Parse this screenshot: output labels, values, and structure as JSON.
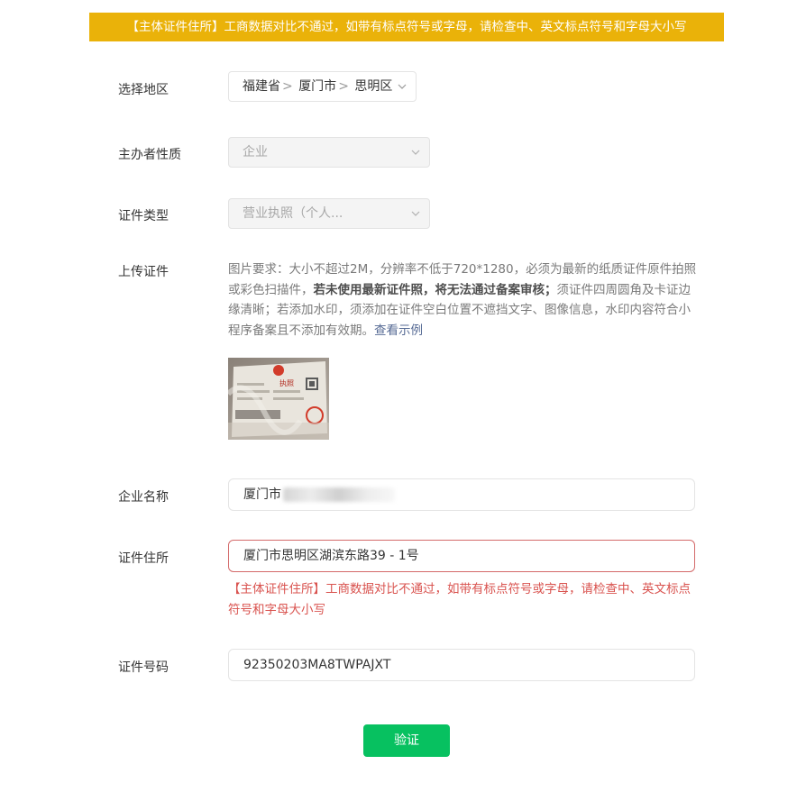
{
  "banner": {
    "text": "【主体证件住所】工商数据对比不通过，如带有标点符号或字母，请检查中、英文标点符号和字母大小写"
  },
  "colors": {
    "banner_bg": "#eab209",
    "primary_button": "#07c160",
    "error": "#d9534f",
    "link": "#576b95"
  },
  "form": {
    "region": {
      "label": "选择地区",
      "province": "福建省",
      "city": "厦门市",
      "district": "思明区",
      "separator": ">"
    },
    "organizer_type": {
      "label": "主办者性质",
      "value": "企业"
    },
    "certificate_type": {
      "label": "证件类型",
      "value": "营业执照（个人..."
    },
    "upload": {
      "label": "上传证件",
      "requirement_1": "图片要求：大小不超过2M，分辨率不低于720*1280，必须为最新的纸质证件原件拍照或彩色扫描件，",
      "requirement_bold": "若未使用最新证件照，将无法通过备案审核；",
      "requirement_2": "须证件四周圆角及卡证边缘清晰；若添加水印，须添加在证件空白位置不遮挡文字、图像信息，水印内容符合小程序备案且不添加有效期。",
      "example_link": "查看示例",
      "thumbnail_title": "执照"
    },
    "company_name": {
      "label": "企业名称",
      "value": "厦门市"
    },
    "certificate_address": {
      "label": "证件住所",
      "value": "厦门市思明区湖滨东路39 - 1号",
      "error": "【主体证件住所】工商数据对比不通过，如带有标点符号或字母，请检查中、英文标点符号和字母大小写"
    },
    "certificate_number": {
      "label": "证件号码",
      "value": "92350203MA8TWPAJXT"
    },
    "submit_label": "验证"
  }
}
